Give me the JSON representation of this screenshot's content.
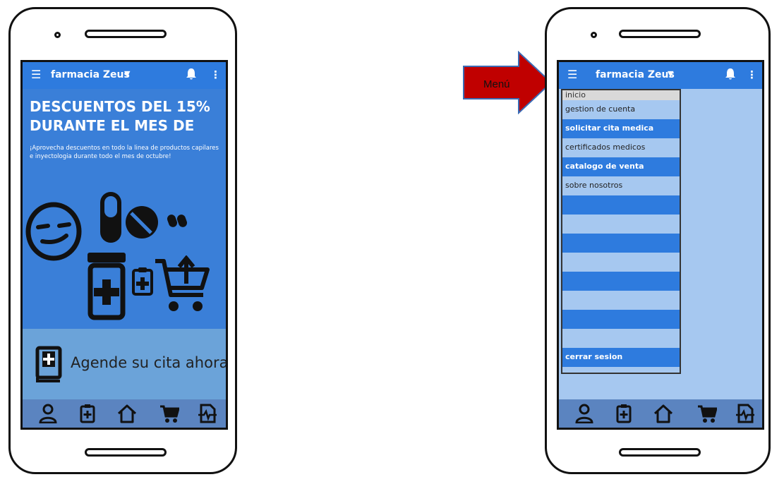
{
  "annotation": {
    "label": "Menú",
    "arrow_color": "#c00000"
  },
  "colors": {
    "appbar": "#2e7bde",
    "screen_bg": "#3a7fd8",
    "cta_bg": "#6ba3d9",
    "nav_bg": "#5b84c0",
    "drawer_light": "#a6c8f0"
  },
  "left_phone": {
    "appbar": {
      "title": "farmacia Zeus",
      "menu_icon": "hamburger-icon",
      "dropdown_icon": "caret-down-icon",
      "notify_icon": "bell-icon",
      "more_icon": "kebab-icon"
    },
    "promo": {
      "title": "DESCUENTOS DEL 15% DURANTE EL MES DE",
      "text": "¡Aprovecha descuentos en todo la linea de productos capilares e inyectologia durante todo el mes de octubre!"
    },
    "illustration_icons": [
      "smirk-face-icon",
      "capsule-icon",
      "pill-tablet-icon",
      "small-capsules-icon",
      "medicine-bottle-icon",
      "clipboard-medical-icon",
      "cart-upload-icon"
    ],
    "cta": {
      "label": "Agende su cita ahora",
      "icon": "medical-book-icon"
    }
  },
  "right_phone": {
    "appbar": {
      "title": "farmacia Zeus"
    },
    "menu_items": [
      {
        "label": "inicio",
        "style": "header"
      },
      {
        "label": "gestion de cuenta",
        "style": "light"
      },
      {
        "label": "solicitar cita medica",
        "style": "dark"
      },
      {
        "label": "certificados medicos",
        "style": "light"
      },
      {
        "label": "catalogo de venta",
        "style": "dark"
      },
      {
        "label": "sobre nosotros",
        "style": "light"
      },
      {
        "label": "",
        "style": "dark"
      },
      {
        "label": "",
        "style": "light"
      },
      {
        "label": "",
        "style": "dark"
      },
      {
        "label": "",
        "style": "light"
      },
      {
        "label": "",
        "style": "dark"
      },
      {
        "label": "",
        "style": "light"
      },
      {
        "label": "",
        "style": "dark"
      },
      {
        "label": "",
        "style": "light"
      },
      {
        "label": "cerrar sesion",
        "style": "dark"
      }
    ]
  },
  "bottom_nav": [
    "user-doctor-icon",
    "clipboard-plus-icon",
    "home-icon",
    "cart-icon",
    "health-file-icon"
  ]
}
